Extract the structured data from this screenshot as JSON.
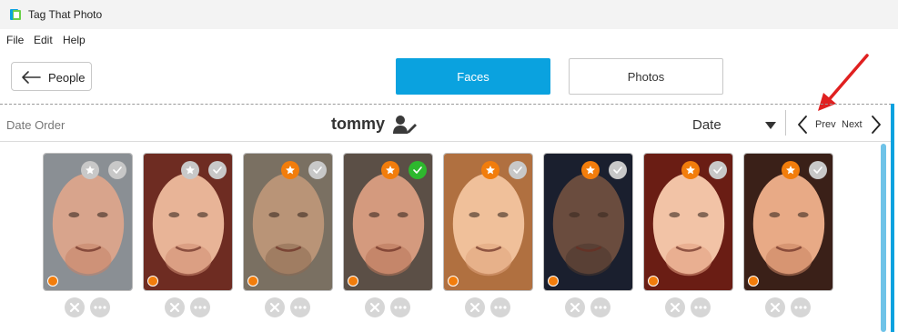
{
  "window": {
    "title": "Tag That Photo"
  },
  "menu": {
    "items": [
      "File",
      "Edit",
      "Help"
    ]
  },
  "toolbar": {
    "back_label": "People"
  },
  "tabs": {
    "faces": "Faces",
    "photos": "Photos",
    "active": "Faces"
  },
  "header": {
    "order_label": "Date Order",
    "person_name": "tommy",
    "sort_value": "Date",
    "prev_label": "Prev",
    "next_label": "Next"
  },
  "colors": {
    "accent": "#0aa2df",
    "star_active": "#f27d0c",
    "star_inactive": "#c8c8c8",
    "confirmed": "#2eb82e",
    "status_dot": "#f27d0c"
  },
  "faces": [
    {
      "starred": false,
      "confirmed": false,
      "bg": [
        "#8a8f94",
        "#d8a48c",
        "#c78468"
      ]
    },
    {
      "starred": false,
      "confirmed": false,
      "bg": [
        "#6e2c22",
        "#e8b497",
        "#cf8e72"
      ]
    },
    {
      "starred": true,
      "confirmed": false,
      "bg": [
        "#7a7062",
        "#b99477",
        "#8c6a52"
      ]
    },
    {
      "starred": true,
      "confirmed": true,
      "bg": [
        "#5b4f46",
        "#d49a7e",
        "#b8775a"
      ]
    },
    {
      "starred": true,
      "confirmed": false,
      "bg": [
        "#b07040",
        "#f0c09a",
        "#e0a47e"
      ]
    },
    {
      "starred": true,
      "confirmed": false,
      "bg": [
        "#1a1f2e",
        "#6a4c3e",
        "#4b372e"
      ]
    },
    {
      "starred": true,
      "confirmed": false,
      "bg": [
        "#6a1d14",
        "#f2c3a6",
        "#e19e80"
      ]
    },
    {
      "starred": true,
      "confirmed": false,
      "bg": [
        "#3a2018",
        "#e8aa86",
        "#c98462"
      ]
    }
  ]
}
